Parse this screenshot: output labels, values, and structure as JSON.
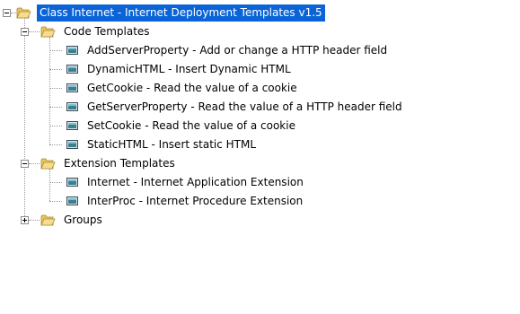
{
  "tree": {
    "root": {
      "label": "Class Internet - Internet Deployment Templates v1.5",
      "expanded": true,
      "selected": true
    },
    "code_templates": {
      "label": "Code Templates",
      "expanded": true,
      "items": [
        "AddServerProperty - Add or change a HTTP header field",
        "DynamicHTML - Insert Dynamic HTML",
        "GetCookie - Read the value of a cookie",
        "GetServerProperty - Read the value of a HTTP header field",
        "SetCookie - Read the value of a cookie",
        "StaticHTML - Insert static HTML"
      ]
    },
    "extension_templates": {
      "label": "Extension Templates",
      "expanded": true,
      "items": [
        "Internet - Internet Application Extension",
        "InterProc - Internet Procedure Extension"
      ]
    },
    "groups": {
      "label": "Groups",
      "expanded": false
    }
  },
  "colors": {
    "selection": "#0a64d8",
    "folder": "#f3d27a",
    "tree_lines": "#9a9a9a"
  },
  "icons": {
    "folder": "folder-open-icon",
    "item": "template-icon"
  }
}
